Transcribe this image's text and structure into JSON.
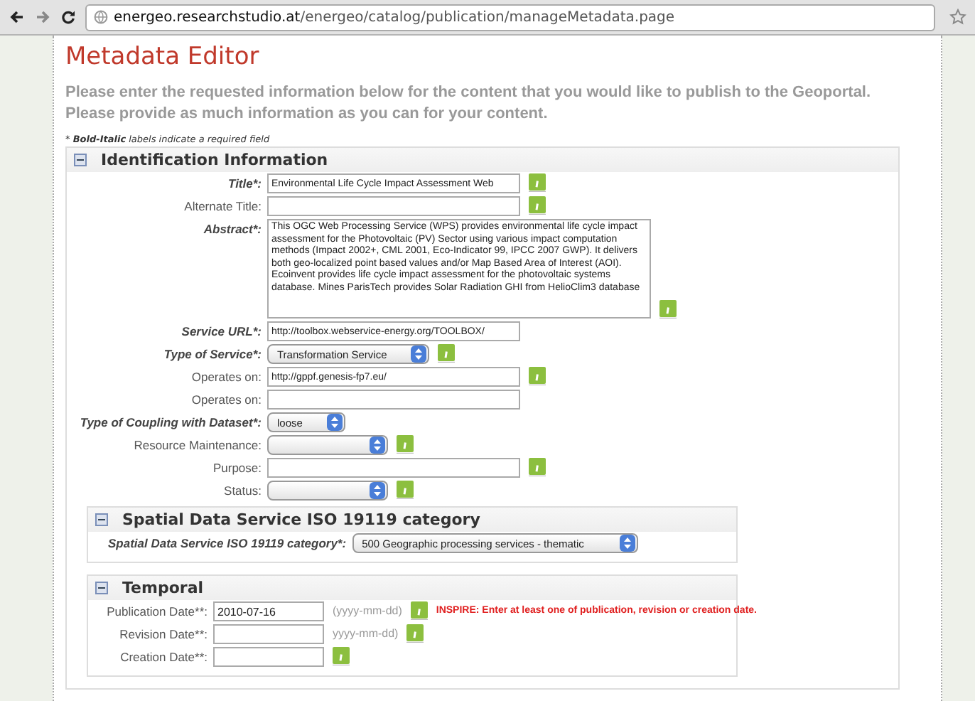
{
  "browser": {
    "url_host": "energeo.researchstudio.at",
    "url_path": "/energeo/catalog/publication/manageMetadata.page"
  },
  "page": {
    "title": "Metadata Editor",
    "intro": "Please enter the requested information below for the content that you would like to publish to the Geoportal. Please provide as much information as you can for your content.",
    "required_note": "* **Bold-Italic** labels indicate a required field"
  },
  "section": {
    "title": "Identification Information",
    "expanded": true,
    "fields": [
      {
        "label": "Title*:",
        "required": true,
        "kind": "text",
        "value": "Environmental Life Cycle Impact Assessment Web",
        "info": true
      },
      {
        "label": "Alternate Title:",
        "required": false,
        "kind": "text",
        "info": true
      },
      {
        "label": "Abstract*:",
        "required": true,
        "kind": "textarea",
        "value": "This OGC Web Processing Service (WPS) provides environmental life cycle impact assessment for the Photovoltaic (PV) Sector using various impact computation methods (Impact 2002+, CML 2001, Eco-Indicator 99, IPCC 2007 GWP). It delivers both geo-localized point based values and/or Map Based Area of Interest (AOI). Ecoinvent provides life cycle impact assessment for the photovoltaic systems database. Mines ParisTech provides Solar Radiation GHI from HelioClim3 database",
        "info": true
      },
      {
        "label": "Service URL*:",
        "required": true,
        "kind": "text",
        "value": "http://toolbox.webservice-energy.org/TOOLBOX/",
        "info": false
      },
      {
        "label": "Type of Service*:",
        "required": true,
        "kind": "select",
        "value": "Transformation Service",
        "info": true
      },
      {
        "label": "Operates on:",
        "required": false,
        "kind": "text",
        "value": "http://gppf.genesis-fp7.eu/",
        "info": true
      },
      {
        "label": "Operates on:",
        "required": false,
        "kind": "text",
        "info": false
      },
      {
        "label": "Type of Coupling with Dataset*:",
        "required": true,
        "kind": "select",
        "value": "loose",
        "info": false
      },
      {
        "label": "Resource Maintenance:",
        "required": false,
        "kind": "select",
        "info": true
      },
      {
        "label": "Purpose:",
        "required": false,
        "kind": "text",
        "info": true
      },
      {
        "label": "Status:",
        "required": false,
        "kind": "select",
        "info": true
      }
    ],
    "subsections": [
      {
        "title": "Spatial Data Service ISO 19119 category",
        "expanded": true,
        "fields": [
          {
            "label": "Spatial Data Service ISO 19119 category*:",
            "required": true,
            "kind": "select",
            "value": "500 Geographic processing services - thematic",
            "info": false
          }
        ]
      },
      {
        "title": "Temporal",
        "expanded": true,
        "fields": [
          {
            "label": "Publication Date**:",
            "required": false,
            "kind": "date",
            "value": "2010-07-16",
            "hint": "(yyyy-mm-dd)",
            "info": true,
            "error": "INSPIRE: Enter at least one of publication, revision or creation date."
          },
          {
            "label": "Revision Date**:",
            "required": false,
            "kind": "date",
            "hint": "yyyy-mm-dd)",
            "info": true
          },
          {
            "label": "Creation Date**:",
            "required": false,
            "kind": "date",
            "info": true
          }
        ]
      }
    ]
  }
}
